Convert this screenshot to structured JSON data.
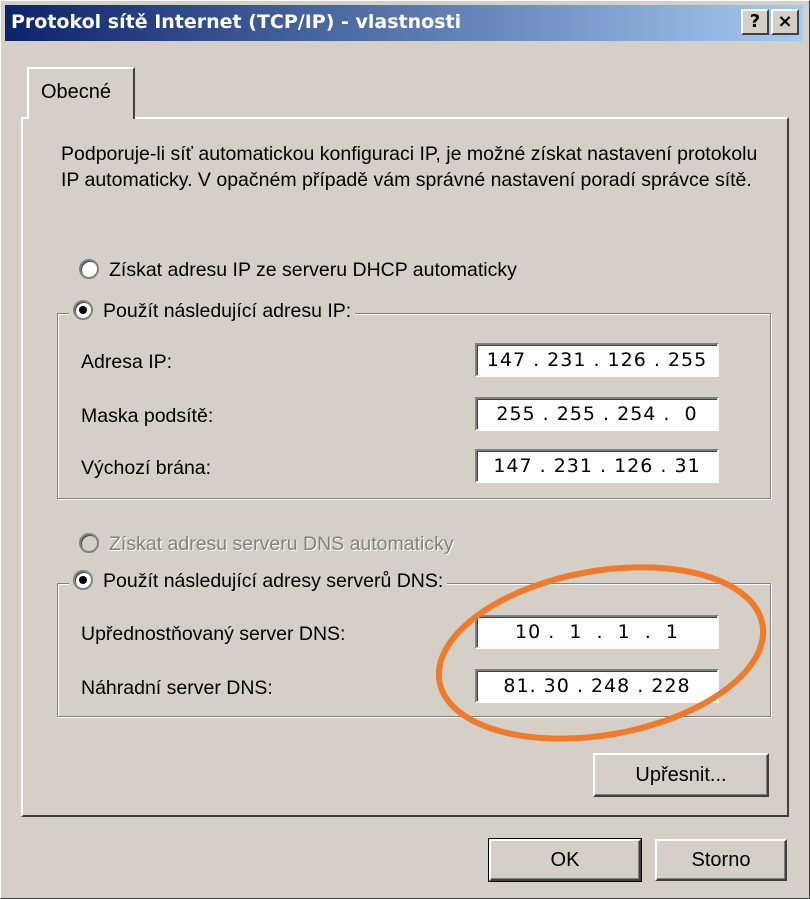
{
  "window": {
    "title": "Protokol sítě Internet (TCP/IP) - vlastnosti",
    "help_label": "?",
    "close_label": "×"
  },
  "tab": {
    "label": "Obecné"
  },
  "description": "Podporuje-li síť automatickou konfiguraci IP, je možné získat nastavení protokolu IP automaticky. V opačném případě vám správné nastavení poradí správce sítě.",
  "ip": {
    "auto_label": "Získat adresu IP ze serveru DHCP automaticky",
    "manual_label": "Použít následující adresu IP:",
    "address_label": "Adresa IP:",
    "address_value": "147 . 231 . 126 . 255",
    "mask_label": "Maska podsítě:",
    "mask_value": "255 . 255 . 254 .  0",
    "gateway_label": "Výchozí brána:",
    "gateway_value": "147 . 231 . 126 . 31"
  },
  "dns": {
    "auto_label": "Získat adresu serveru DNS automaticky",
    "manual_label": "Použít následující adresy serverů DNS:",
    "preferred_label": "Upřednostňovaný server DNS:",
    "preferred_value": "10 .  1  .  1  .  1",
    "alternate_label": "Náhradní server DNS:",
    "alternate_value": "81. 30 . 248 . 228"
  },
  "buttons": {
    "advanced_label": "Upřesnit...",
    "ok_label": "OK",
    "cancel_label": "Storno"
  },
  "colors": {
    "title_gradient_start": "#0a246a",
    "title_gradient_end": "#a6caf0",
    "face": "#d4d0c8",
    "highlight_ellipse": "#f07a2a"
  }
}
